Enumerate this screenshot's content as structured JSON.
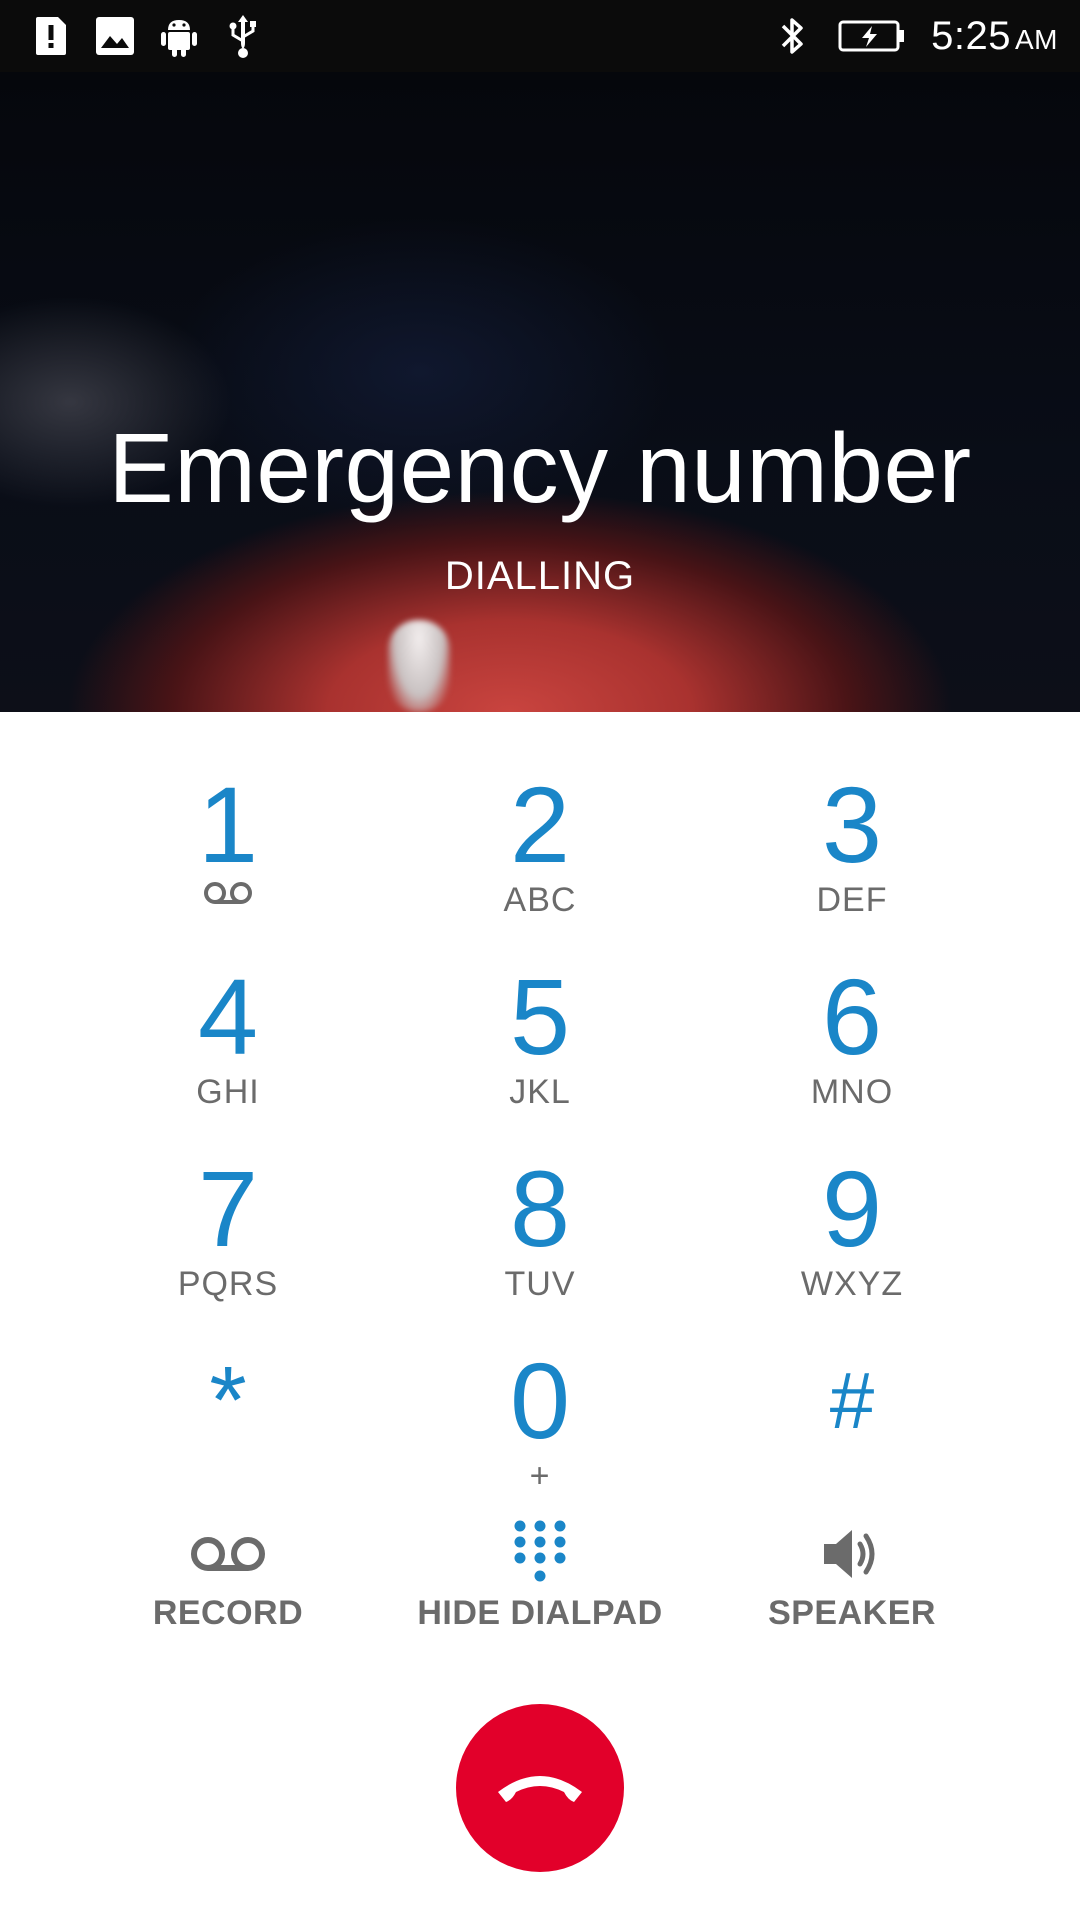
{
  "status_bar": {
    "left_icons": [
      "alert-sim-icon",
      "image-icon",
      "android-icon",
      "usb-icon"
    ],
    "right_icons": [
      "bluetooth-icon",
      "battery-charging-icon"
    ],
    "time": "5:25",
    "ampm": "AM"
  },
  "call": {
    "name": "Emergency number",
    "state": "DIALLING"
  },
  "dialpad": {
    "keys": [
      {
        "digit": "1",
        "letters": ""
      },
      {
        "digit": "2",
        "letters": "ABC"
      },
      {
        "digit": "3",
        "letters": "DEF"
      },
      {
        "digit": "4",
        "letters": "GHI"
      },
      {
        "digit": "5",
        "letters": "JKL"
      },
      {
        "digit": "6",
        "letters": "MNO"
      },
      {
        "digit": "7",
        "letters": "PQRS"
      },
      {
        "digit": "8",
        "letters": "TUV"
      },
      {
        "digit": "9",
        "letters": "WXYZ"
      },
      {
        "digit": "*",
        "letters": ""
      },
      {
        "digit": "0",
        "letters": "+"
      },
      {
        "digit": "#",
        "letters": ""
      }
    ]
  },
  "actions": {
    "record": "RECORD",
    "hide_dialpad": "HIDE DIALPAD",
    "speaker": "SPEAKER"
  },
  "colors": {
    "accent": "#1a86c8",
    "end_call": "#e2002a",
    "secondary_text": "#6b6b6b"
  }
}
